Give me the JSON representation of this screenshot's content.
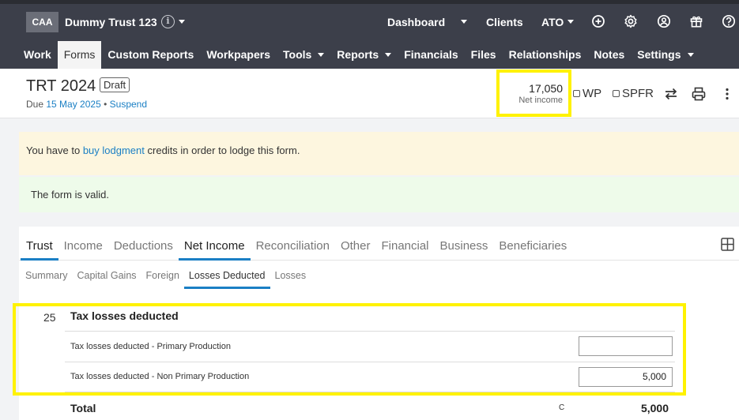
{
  "org": {
    "logo": "CAA",
    "name": "Dummy Trust 123",
    "info_icon": "info-icon"
  },
  "topnav": {
    "dashboard": "Dashboard",
    "clients": "Clients",
    "ato": "ATO",
    "icons": [
      "plus-circle-icon",
      "gear-icon",
      "user-circle-icon",
      "gift-icon",
      "help-icon"
    ]
  },
  "menu": [
    "Work",
    "Forms",
    "Custom Reports",
    "Workpapers",
    "Tools",
    "Reports",
    "Financials",
    "Files",
    "Relationships",
    "Notes",
    "Settings"
  ],
  "menu_active": "Forms",
  "header": {
    "title": "TRT 2024",
    "badge": "Draft",
    "due_prefix": "Due",
    "due_date": "15 May 2025",
    "bullet": "•",
    "suspend": "Suspend",
    "net_income_value": "17,050",
    "net_income_label": "Net income",
    "wp": "WP",
    "spfr": "SPFR"
  },
  "alerts": {
    "warn_prefix": "You have to",
    "warn_link": "buy lodgment",
    "warn_suffix": "credits in order to lodge this form.",
    "ok": "The form is valid."
  },
  "tabs": {
    "main": [
      "Trust",
      "Income",
      "Deductions",
      "Net Income",
      "Reconciliation",
      "Other",
      "Financial",
      "Business",
      "Beneficiaries"
    ],
    "main_active": "Net Income",
    "sub": [
      "Summary",
      "Capital Gains",
      "Foreign",
      "Losses Deducted",
      "Losses"
    ],
    "sub_active": "Losses Deducted"
  },
  "section": {
    "number": "25",
    "title": "Tax losses deducted",
    "rows": [
      {
        "label": "Tax losses deducted - Primary Production",
        "value": ""
      },
      {
        "label": "Tax losses deducted - Non Primary Production",
        "value": "5,000"
      }
    ],
    "total_label": "Total",
    "total_code": "C",
    "total_value": "5,000"
  }
}
